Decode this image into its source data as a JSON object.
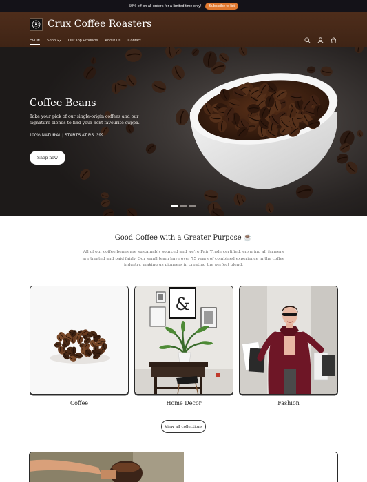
{
  "announcement": {
    "text": "50% off on all orders for a limited time only!",
    "button": "Subscribe to list"
  },
  "header": {
    "brand": "Crux Coffee Roasters",
    "nav": [
      {
        "label": "Home",
        "active": true
      },
      {
        "label": "Shop",
        "has_dropdown": true
      },
      {
        "label": "Our Top Products"
      },
      {
        "label": "About Us"
      },
      {
        "label": "Contact"
      }
    ],
    "icons": [
      "search-icon",
      "account-icon",
      "cart-icon"
    ]
  },
  "hero": {
    "title": "Coffee Beans",
    "description": "Take your pick of our single-origin coffees and our signature blends to find your next favourite cuppa.",
    "tagline": "100% NATURAL  |  STARTS AT RS. 399",
    "button": "Shop now",
    "slides": 3,
    "active_slide": 1
  },
  "purpose": {
    "title": "Good Coffee with a Greater Purpose ☕",
    "text": "All of our coffee beans are sustainably sourced and we're Fair Trade certified, ensuring all farmers are treated and paid fairly. Our small team have over 75 years of combined experience in the coffee industry, making us pioneers in creating the perfect blend."
  },
  "collections": {
    "items": [
      {
        "label": "Coffee"
      },
      {
        "label": "Home Decor"
      },
      {
        "label": "Fashion"
      }
    ],
    "view_all": "View all collections"
  },
  "colors": {
    "header_bg": "#4e2d1b",
    "announcement_bg": "#141218",
    "accent": "#e0782f"
  }
}
